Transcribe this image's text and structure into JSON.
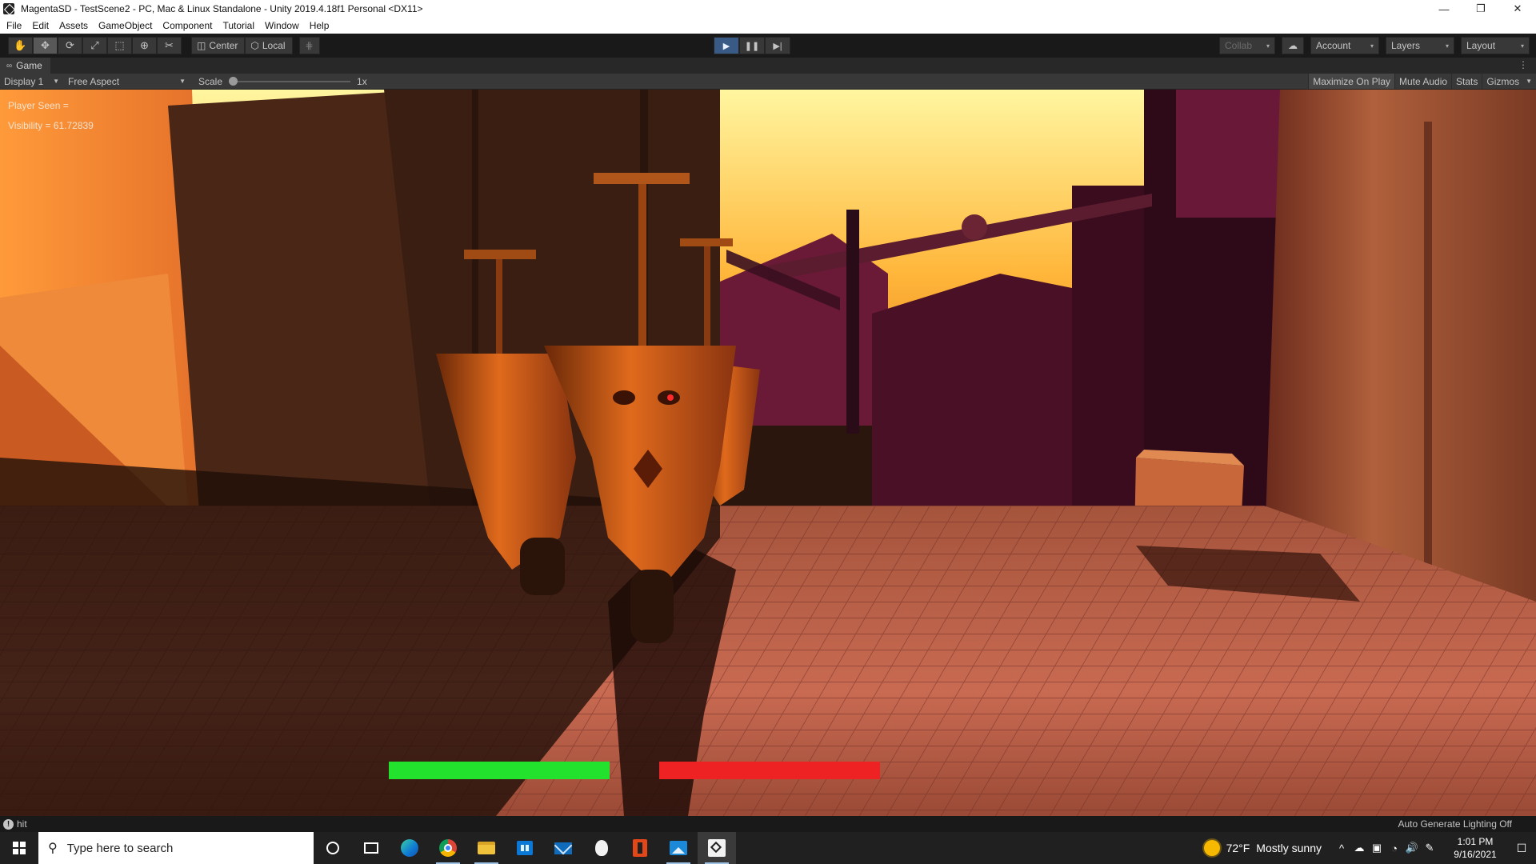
{
  "window": {
    "title": "MagentaSD - TestScene2 - PC, Mac & Linux Standalone - Unity 2019.4.18f1 Personal <DX11>",
    "minimize": "—",
    "restore": "❐",
    "close": "✕"
  },
  "menu": [
    "File",
    "Edit",
    "Assets",
    "GameObject",
    "Component",
    "Tutorial",
    "Window",
    "Help"
  ],
  "toolbar": {
    "tools": [
      {
        "name": "hand-tool",
        "icon": "✋"
      },
      {
        "name": "move-tool",
        "icon": "✥"
      },
      {
        "name": "rotate-tool",
        "icon": "⟳"
      },
      {
        "name": "scale-tool",
        "icon": "⤢"
      },
      {
        "name": "rect-tool",
        "icon": "⬚"
      },
      {
        "name": "transform-tool",
        "icon": "⊕"
      },
      {
        "name": "custom-tool",
        "icon": "✂"
      }
    ],
    "active_tool": "move-tool",
    "pivot_center": "Center",
    "pivot_local": "Local",
    "grid_icon": "⋕",
    "play_icon": "▶",
    "pause_icon": "❚❚",
    "step_icon": "▶|",
    "collab": "Collab",
    "account": "Account",
    "layers": "Layers",
    "layout": "Layout",
    "caret": "▾",
    "cloud_icon": "☁"
  },
  "game_view": {
    "tab_label": "Game",
    "tab_icon": "∞",
    "tab_menu": "⋮",
    "display": "Display 1",
    "aspect": "Free Aspect",
    "scale_label": "Scale",
    "scale_value": "1x",
    "scale_slider_level": 0,
    "maximize_on_play": "Maximize On Play",
    "mute_audio": "Mute Audio",
    "stats": "Stats",
    "gizmos": "Gizmos",
    "debug_lines": [
      "Player Seen = ",
      "Visibility = 61.72839"
    ],
    "health_bars": [
      {
        "name": "player",
        "color": "#22e22e",
        "fill": 1.0
      },
      {
        "name": "enemy",
        "color": "#ee2222",
        "fill": 1.0
      }
    ]
  },
  "status": {
    "icon": "!",
    "message": "hit",
    "lighting": "Auto Generate Lighting Off"
  },
  "taskbar": {
    "search_placeholder": "Type here to search",
    "search_icon": "⚲",
    "apps": [
      "cortana",
      "task-view",
      "edge",
      "chrome",
      "file-explorer",
      "store",
      "mail",
      "alien-app",
      "office",
      "photos",
      "unity"
    ],
    "weather_temp": "72°F",
    "weather_desc": "Mostly sunny",
    "time": "1:01 PM",
    "date": "9/16/2021",
    "tray_icons": [
      "^",
      "☁",
      "▣",
      "◔",
      "🔊",
      "✎"
    ],
    "notification_icon": "☐"
  }
}
